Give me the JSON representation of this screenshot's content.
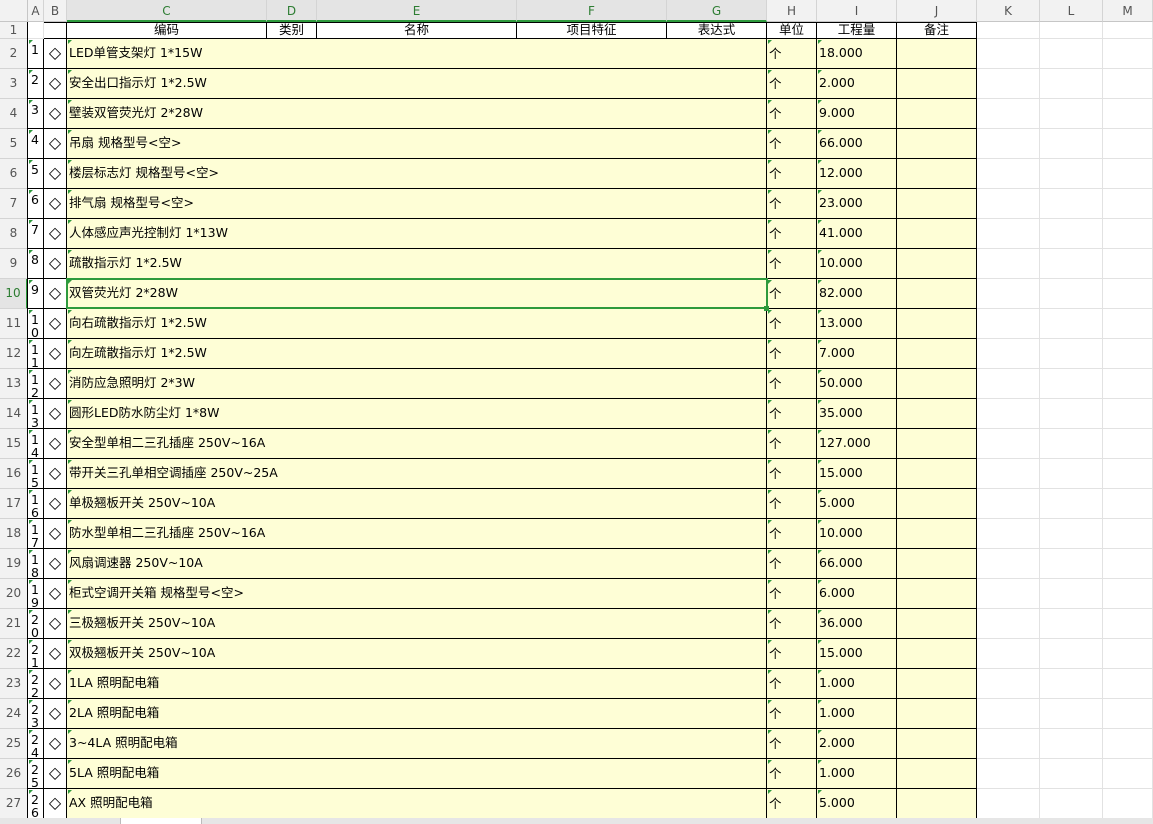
{
  "columns": [
    "A",
    "B",
    "C",
    "D",
    "E",
    "F",
    "G",
    "H",
    "I",
    "J",
    "K",
    "L",
    "M"
  ],
  "selected_column_letters": [
    "C",
    "D",
    "E",
    "F",
    "G"
  ],
  "selected_row": 10,
  "header_row": {
    "code": "编码",
    "category": "类别",
    "name": "名称",
    "features": "项目特征",
    "expression": "表达式",
    "unit": "单位",
    "quantity": "工程量",
    "remark": "备注"
  },
  "rows": [
    {
      "row": 2,
      "seq": "1",
      "name": "LED单管支架灯 1*15W",
      "unit": "个",
      "qty": "18.000"
    },
    {
      "row": 3,
      "seq": "2",
      "name": "安全出口指示灯 1*2.5W",
      "unit": "个",
      "qty": "2.000"
    },
    {
      "row": 4,
      "seq": "3",
      "name": "壁装双管荧光灯 2*28W",
      "unit": "个",
      "qty": "9.000"
    },
    {
      "row": 5,
      "seq": "4",
      "name": "吊扇 规格型号<空>",
      "unit": "个",
      "qty": "66.000"
    },
    {
      "row": 6,
      "seq": "5",
      "name": "楼层标志灯 规格型号<空>",
      "unit": "个",
      "qty": "12.000"
    },
    {
      "row": 7,
      "seq": "6",
      "name": "排气扇 规格型号<空>",
      "unit": "个",
      "qty": "23.000"
    },
    {
      "row": 8,
      "seq": "7",
      "name": "人体感应声光控制灯 1*13W",
      "unit": "个",
      "qty": "41.000"
    },
    {
      "row": 9,
      "seq": "8",
      "name": "疏散指示灯 1*2.5W",
      "unit": "个",
      "qty": "10.000"
    },
    {
      "row": 10,
      "seq": "9",
      "name": "双管荧光灯 2*28W",
      "unit": "个",
      "qty": "82.000"
    },
    {
      "row": 11,
      "seq": "10",
      "name": "向右疏散指示灯 1*2.5W",
      "unit": "个",
      "qty": "13.000"
    },
    {
      "row": 12,
      "seq": "11",
      "name": "向左疏散指示灯 1*2.5W",
      "unit": "个",
      "qty": "7.000"
    },
    {
      "row": 13,
      "seq": "12",
      "name": "消防应急照明灯 2*3W",
      "unit": "个",
      "qty": "50.000"
    },
    {
      "row": 14,
      "seq": "13",
      "name": "圆形LED防水防尘灯 1*8W",
      "unit": "个",
      "qty": "35.000"
    },
    {
      "row": 15,
      "seq": "14",
      "name": "安全型单相二三孔插座 250V~16A",
      "unit": "个",
      "qty": "127.000"
    },
    {
      "row": 16,
      "seq": "15",
      "name": "带开关三孔单相空调插座 250V~25A",
      "unit": "个",
      "qty": "15.000"
    },
    {
      "row": 17,
      "seq": "16",
      "name": "单极翘板开关 250V~10A",
      "unit": "个",
      "qty": "5.000"
    },
    {
      "row": 18,
      "seq": "17",
      "name": "防水型单相二三孔插座 250V~16A",
      "unit": "个",
      "qty": "10.000"
    },
    {
      "row": 19,
      "seq": "18",
      "name": "风扇调速器 250V~10A",
      "unit": "个",
      "qty": "66.000"
    },
    {
      "row": 20,
      "seq": "19",
      "name": "柜式空调开关箱 规格型号<空>",
      "unit": "个",
      "qty": "6.000"
    },
    {
      "row": 21,
      "seq": "20",
      "name": "三极翘板开关 250V~10A",
      "unit": "个",
      "qty": "36.000"
    },
    {
      "row": 22,
      "seq": "21",
      "name": "双极翘板开关 250V~10A",
      "unit": "个",
      "qty": "15.000"
    },
    {
      "row": 23,
      "seq": "22",
      "name": "1LA 照明配电箱",
      "unit": "个",
      "qty": "1.000"
    },
    {
      "row": 24,
      "seq": "23",
      "name": "2LA 照明配电箱",
      "unit": "个",
      "qty": "1.000"
    },
    {
      "row": 25,
      "seq": "24",
      "name": "3~4LA 照明配电箱",
      "unit": "个",
      "qty": "2.000"
    },
    {
      "row": 26,
      "seq": "25",
      "name": "5LA 照明配电箱",
      "unit": "个",
      "qty": "1.000"
    },
    {
      "row": 27,
      "seq": "26",
      "name": "AX 照明配电箱",
      "unit": "个",
      "qty": "5.000"
    }
  ],
  "colors": {
    "cell_fill": "#fefed6",
    "selection": "#2e9a3d",
    "header_bg": "#f2f2f2"
  }
}
